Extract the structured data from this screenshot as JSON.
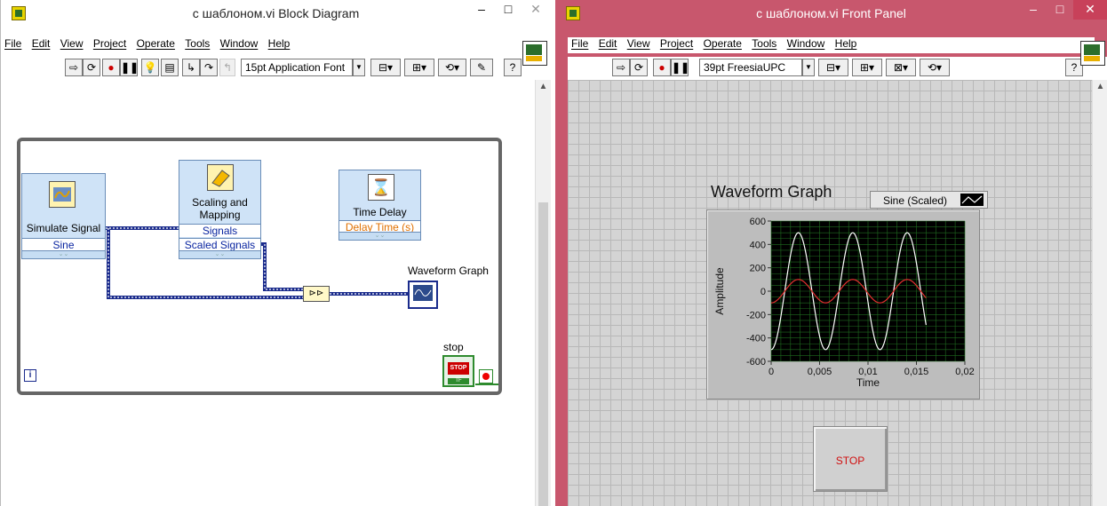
{
  "block_diagram": {
    "title": "с шаблоном.vi Block Diagram",
    "menu": [
      "File",
      "Edit",
      "View",
      "Project",
      "Operate",
      "Tools",
      "Window",
      "Help"
    ],
    "font_select": "15pt Application Font",
    "simulate_signal": {
      "title": "Simulate Signal",
      "terminal": "Sine"
    },
    "scaling": {
      "title_line1": "Scaling and",
      "title_line2": "Mapping",
      "terminal1": "Signals",
      "terminal2": "Scaled Signals"
    },
    "time_delay": {
      "title": "Time Delay",
      "terminal": "Delay Time (s)"
    },
    "graph_label": "Waveform Graph",
    "stop_label": "stop",
    "stop_inner": "STOP",
    "tf_label": "TF",
    "iteration": "i"
  },
  "front_panel": {
    "title": "с шаблоном.vi Front Panel",
    "menu": [
      "File",
      "Edit",
      "View",
      "Project",
      "Operate",
      "Tools",
      "Window",
      "Help"
    ],
    "font_select": "39pt FreesiaUPC",
    "graph_title": "Waveform Graph",
    "legend": "Sine (Scaled)",
    "stop_button": "STOP"
  },
  "window_controls": {
    "minimize": "–",
    "maximize": "□",
    "close": "✕"
  },
  "colors": {
    "plot_bg": "#000000",
    "grid": "#1f6b1f",
    "sine_scaled": "#ffffff",
    "sine_raw": "#e53030",
    "wire_dynamic": "#1a2b8c",
    "fp_window": "#c8576d"
  },
  "chart_data": {
    "type": "line",
    "title": "Waveform Graph",
    "xlabel": "Time",
    "ylabel": "Amplitude",
    "xlim": [
      0,
      0.02
    ],
    "ylim": [
      -600,
      600
    ],
    "x_ticks": [
      "0",
      "0,005",
      "0,01",
      "0,015",
      "0,02"
    ],
    "y_ticks": [
      "600",
      "400",
      "200",
      "0",
      "-200",
      "-400",
      "-600"
    ],
    "series": [
      {
        "name": "Sine (Scaled)",
        "amplitude": 500,
        "frequency_hz": 178,
        "phase_deg": -90,
        "x_end": 0.016
      },
      {
        "amplitude": 100,
        "frequency_hz": 178,
        "phase_deg": -90,
        "x_end": 0.016
      }
    ]
  }
}
